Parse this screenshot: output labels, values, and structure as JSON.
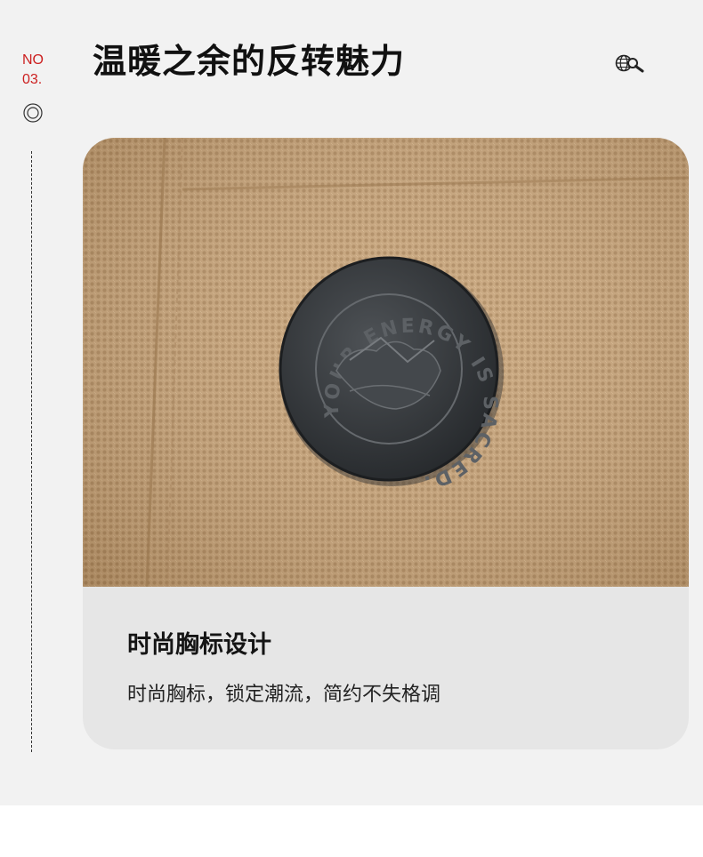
{
  "section": {
    "number_line1": "NO",
    "number_line2": "03.",
    "title": "温暖之余的反转魅力"
  },
  "icons": {
    "bullet": "double-circle-icon",
    "header_icon": "globe-search-icon"
  },
  "photo": {
    "badge_text": "YOUR ENERGY IS SACRED.",
    "fabric_color": "#c7a47a",
    "badge_color": "#3a3d40"
  },
  "caption": {
    "title": "时尚胸标设计",
    "description": "时尚胸标，锁定潮流，简约不失格调"
  },
  "colors": {
    "accent": "#cc1f1f",
    "background": "#f2f2f2",
    "card": "#e6e6e6"
  }
}
